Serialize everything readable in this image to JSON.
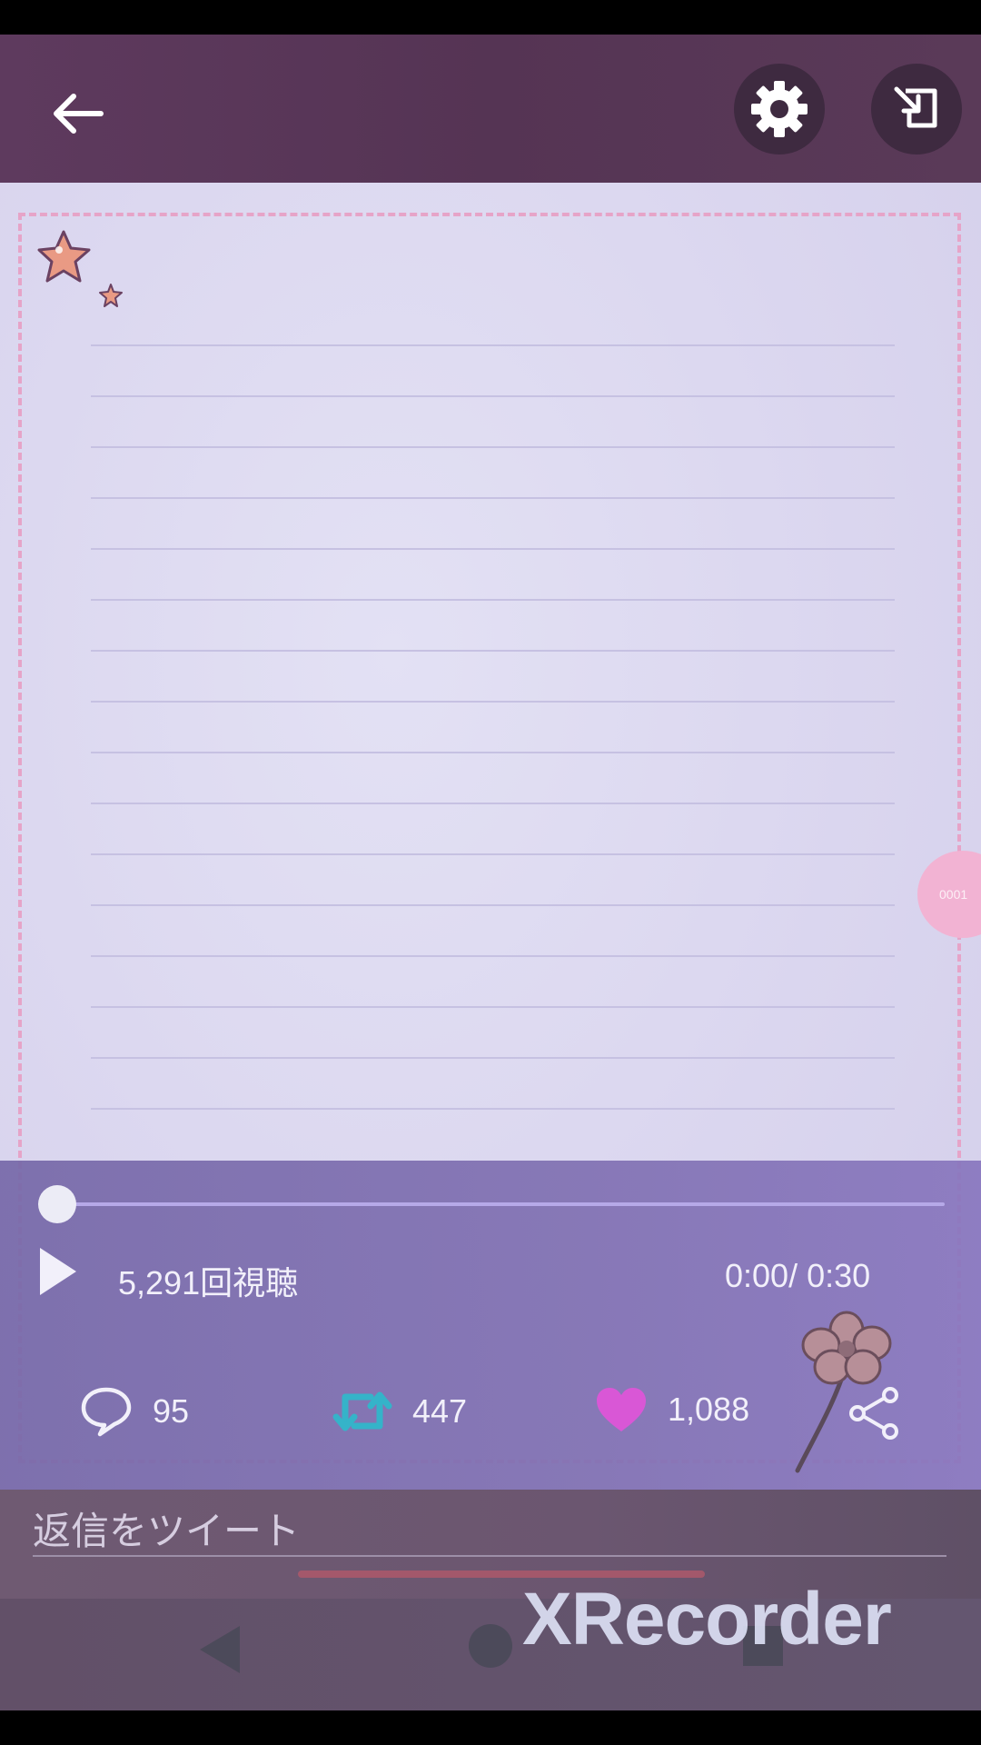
{
  "player": {
    "views": "5,291回視聴",
    "time": "0:00/ 0:30",
    "progress": 0
  },
  "actions": {
    "replies": "95",
    "retweets": "447",
    "likes": "1,088"
  },
  "reply": {
    "label": "返信をツイート"
  },
  "side_tab": {
    "text": "0001"
  },
  "watermark": "XRecorder",
  "colors": {
    "retweet": "#35b3c9",
    "like": "#d957d6",
    "note_border": "#e6a4c8"
  },
  "icons": [
    "arrow-left-icon",
    "gear-icon",
    "popout-icon",
    "play-icon",
    "comment-icon",
    "retweet-icon",
    "heart-icon",
    "share-icon"
  ]
}
